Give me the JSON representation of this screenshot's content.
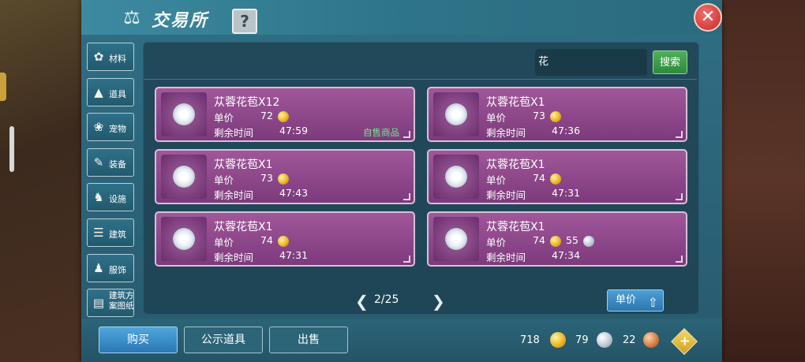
{
  "background": {
    "npc_names": [
      "",
      "",
      ""
    ]
  },
  "header": {
    "title": "交易所",
    "title_icon": "scales-icon",
    "help_label": "?",
    "close_label": "✕"
  },
  "categories": [
    {
      "label": "材料",
      "icon": "material-icon"
    },
    {
      "label": "道具",
      "icon": "flask-icon"
    },
    {
      "label": "宠物",
      "icon": "paw-icon"
    },
    {
      "label": "装备",
      "icon": "equipment-icon"
    },
    {
      "label": "设施",
      "icon": "facility-icon"
    },
    {
      "label": "建筑",
      "icon": "building-icon"
    },
    {
      "label": "服饰",
      "icon": "clothing-icon"
    },
    {
      "label": "建筑方案图纸",
      "icon": "blueprint-icon"
    }
  ],
  "search": {
    "value": "花",
    "button_label": "搜索"
  },
  "labels": {
    "unit_price": "单价",
    "remaining_time": "剩余时间",
    "self_sale": "自售商品"
  },
  "listings": [
    {
      "name": "苁蓉花苞X12",
      "price_gold": "72",
      "price_silver": "",
      "time": "47:59",
      "self_sale": true
    },
    {
      "name": "苁蓉花苞X1",
      "price_gold": "73",
      "price_silver": "",
      "time": "47:36",
      "self_sale": false
    },
    {
      "name": "苁蓉花苞X1",
      "price_gold": "73",
      "price_silver": "",
      "time": "47:43",
      "self_sale": false
    },
    {
      "name": "苁蓉花苞X1",
      "price_gold": "74",
      "price_silver": "",
      "time": "47:31",
      "self_sale": false
    },
    {
      "name": "苁蓉花苞X1",
      "price_gold": "74",
      "price_silver": "",
      "time": "47:31",
      "self_sale": false
    },
    {
      "name": "苁蓉花苞X1",
      "price_gold": "74",
      "price_silver": "55",
      "time": "47:34",
      "self_sale": false
    }
  ],
  "pagination": {
    "current": "2/25",
    "prev": "❮",
    "next": "❯"
  },
  "sort": {
    "label": "单价"
  },
  "footer": {
    "buy_label": "购买",
    "public_label": "公示道具",
    "sell_label": "出售",
    "gold": "718",
    "silver": "79",
    "bronze": "22",
    "add_label": "+"
  },
  "colors": {
    "panel": "#2f6f86",
    "item_bg": "#a0579a",
    "accent_blue": "#2a78b4",
    "search_green": "#2d8a3c",
    "self_sale_text": "#6ee88a"
  }
}
